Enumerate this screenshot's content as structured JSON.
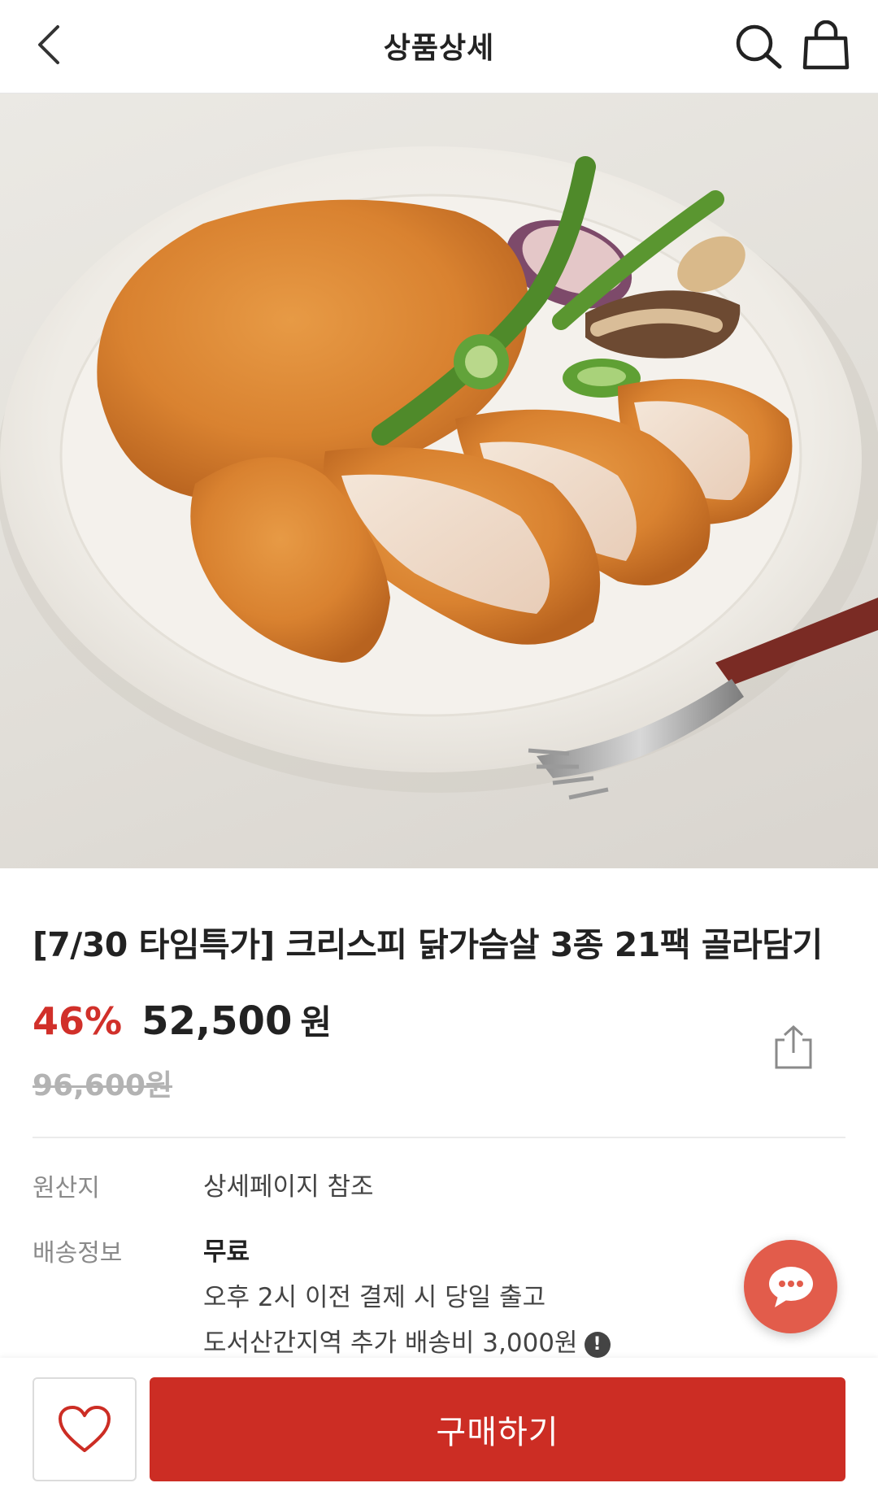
{
  "header": {
    "title": "상품상세",
    "back_icon": "chevron-left-icon",
    "search_icon": "search-icon",
    "cart_icon": "shopping-bag-icon"
  },
  "product": {
    "image_alt": "crispy chicken breast cutlet on plate",
    "title": "[7/30 타임특가] 크리스피 닭가슴살 3종 21팩 골라담기",
    "discount": "46%",
    "price": "52,500",
    "price_unit": "원",
    "original_price": "96,600원"
  },
  "specs": {
    "origin_label": "원산지",
    "origin_value": "상세페이지 참조",
    "delivery_label": "배송정보",
    "delivery_fee": "무료",
    "delivery_line1": "오후 2시 이전 결제 시 당일 출고",
    "delivery_line2": "도서산간지역 추가 배송비 3,000원",
    "notice_icon_text": "!"
  },
  "actions": {
    "share_icon": "share-icon",
    "chat_icon": "chat-bubble-icon",
    "wishlist_icon": "heart-icon",
    "buy_label": "구매하기"
  },
  "colors": {
    "accent": "#cc2d24",
    "discount": "#d1302a",
    "chat_fab": "#e25c4b"
  }
}
